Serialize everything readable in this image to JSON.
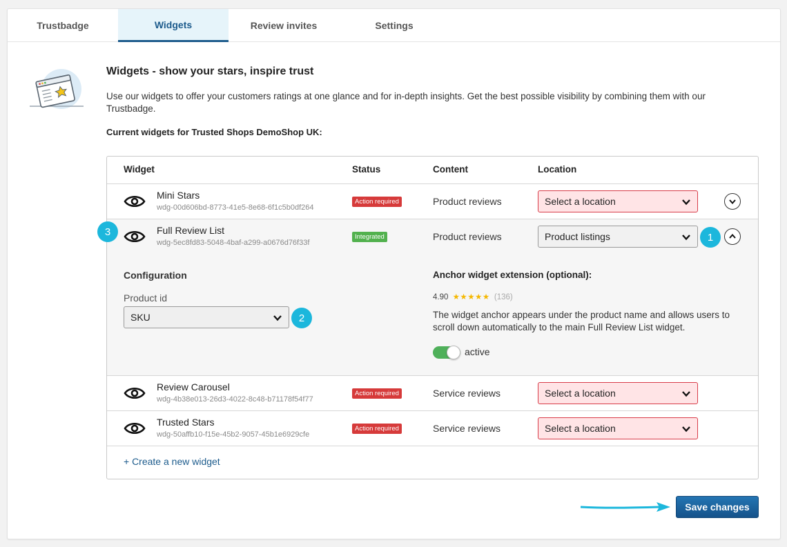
{
  "tabs": [
    {
      "label": "Trustbadge",
      "active": false
    },
    {
      "label": "Widgets",
      "active": true
    },
    {
      "label": "Review invites",
      "active": false
    },
    {
      "label": "Settings",
      "active": false
    }
  ],
  "header": {
    "title": "Widgets - show your stars, inspire trust",
    "intro": "Use our widgets to offer your customers ratings at one glance and for in-depth insights. Get the best possible visibility by combining them with our Trustbadge.",
    "current_title": "Current widgets for Trusted Shops DemoShop UK:"
  },
  "table": {
    "columns": [
      "Widget",
      "Status",
      "Content",
      "Location"
    ],
    "rows": [
      {
        "name": "Mini Stars",
        "id": "wdg-00d606bd-8773-41e5-8e68-6f1c5b0df264",
        "status": "Action required",
        "status_type": "error",
        "content": "Product reviews",
        "location": "Select a location",
        "location_error": true,
        "expanded": false
      },
      {
        "name": "Full Review List",
        "id": "wdg-5ec8fd83-5048-4baf-a299-a0676d76f33f",
        "status": "Integrated",
        "status_type": "ok",
        "content": "Product reviews",
        "location": "Product listings",
        "location_error": false,
        "expanded": true
      },
      {
        "name": "Review Carousel",
        "id": "wdg-4b38e013-26d3-4022-8c48-b71178f54f77",
        "status": "Action required",
        "status_type": "error",
        "content": "Service reviews",
        "location": "Select a location",
        "location_error": true,
        "expanded": false
      },
      {
        "name": "Trusted Stars",
        "id": "wdg-50affb10-f15e-45b2-9057-45b1e6929cfe",
        "status": "Action required",
        "status_type": "error",
        "content": "Service reviews",
        "location": "Select a location",
        "location_error": true,
        "expanded": false
      }
    ],
    "config": {
      "title": "Configuration",
      "product_id_label": "Product id",
      "product_id_value": "SKU",
      "anchor_title": "Anchor widget extension (optional):",
      "rating_value": "4.90",
      "rating_stars": "★★★★★",
      "rating_count": "(136)",
      "anchor_desc": "The widget anchor appears under the product name and allows users to scroll down automatically to the main Full Review List widget.",
      "toggle_label": "active",
      "toggle_on": true
    },
    "create_link": "+ Create a new widget"
  },
  "annotations": [
    "1",
    "2",
    "3"
  ],
  "actions": {
    "save_label": "Save changes"
  },
  "colors": {
    "accent": "#1c5b8c",
    "error": "#d63a3a",
    "success": "#52b14e",
    "annotation": "#1cb7dc"
  }
}
